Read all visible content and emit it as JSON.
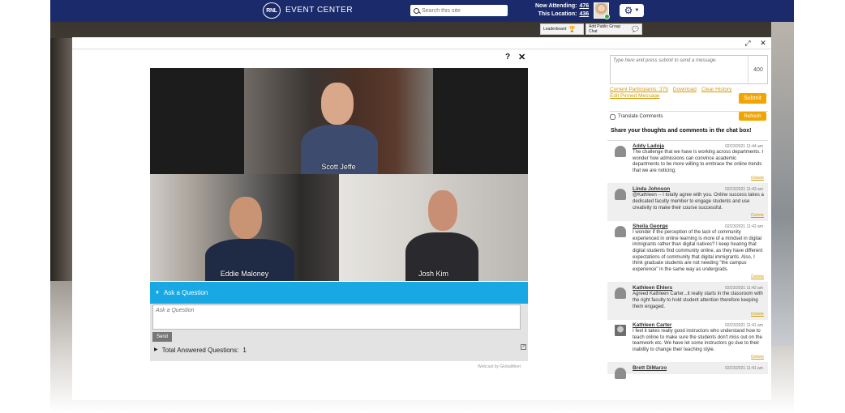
{
  "topbar": {
    "logo": "RNL",
    "brand": "EVENT CENTER",
    "search_placeholder": "Search this site",
    "now_attending_label": "Now Attending:",
    "now_attending_value": "476",
    "this_location_label": "This Location:",
    "this_location_value": "436"
  },
  "subtabs": {
    "leaderboard": "Leaderboard",
    "add_chat": "Add Public Group Chat"
  },
  "modal": {
    "help": "?",
    "close": "✕"
  },
  "video": {
    "participants": [
      {
        "name": "Scott Jeffe"
      },
      {
        "name": "Eddie Maloney"
      },
      {
        "name": "Josh Kim"
      }
    ]
  },
  "qa": {
    "header": "Ask a Question",
    "placeholder": "Ask a Question",
    "send": "Send",
    "answered_label": "Total Answered Questions:",
    "answered_count": "1",
    "webcast_label": "Webcast by",
    "webcast_brand": "GlobalMeet"
  },
  "chat": {
    "placeholder": "Type here and press submit to send a message.",
    "char_count": "400",
    "links": {
      "participants": "Current Participants: 379",
      "download": "Download",
      "clear": "Clear History",
      "edit_pinned": "Edit Pinned Message"
    },
    "submit": "Submit",
    "translate": "Translate Comments",
    "refresh": "Refresh",
    "prompt": "Share your thoughts and comments in the chat box!",
    "delete_label": "Delete",
    "messages": [
      {
        "author": "Addy Ladoja",
        "time": "02/23/2021 11:44 am",
        "text": "The challenge that we have is working across departments. I wonder how admissions can convince academic departments to be more willing to embrace the online trends that we are noticing."
      },
      {
        "author": "Linda Johnson",
        "time": "02/23/2021 11:43 am",
        "text": "@Kathleen -- I totally agree with you. Online success takes a dedicated faculty member to engage students and use creativity to make their course successful."
      },
      {
        "author": "Sheila George",
        "time": "02/23/2021 11:42 am",
        "text": "I wonder if the perception of the lack of community experienced in online learning is more of a mindset in digital immigrants rather than digital natives? I keep hearing that digital students find community online, as they have different expectations of community that digital immigrants. Also, I think graduate students are not needing \"the campus experience\" in the same way as undergrads."
      },
      {
        "author": "Kathleen Ehlers",
        "time": "02/23/2021 11:42 am",
        "text": "Agreed Kathleen Carter...it really starts in the classroom with the right faculty to hold student attention therefore keeping them engaged."
      },
      {
        "author": "Kathleen Carter",
        "time": "02/23/2021 11:41 am",
        "text": "I feel it takes really good instructors who understand how to teach online to make sure the students don't miss out on the teamwork etc. We have let some instructors go due to their inability to change their teaching style."
      },
      {
        "author": "Brett DiMarzo",
        "time": "02/23/2021 11:41 am",
        "text": ""
      }
    ]
  }
}
